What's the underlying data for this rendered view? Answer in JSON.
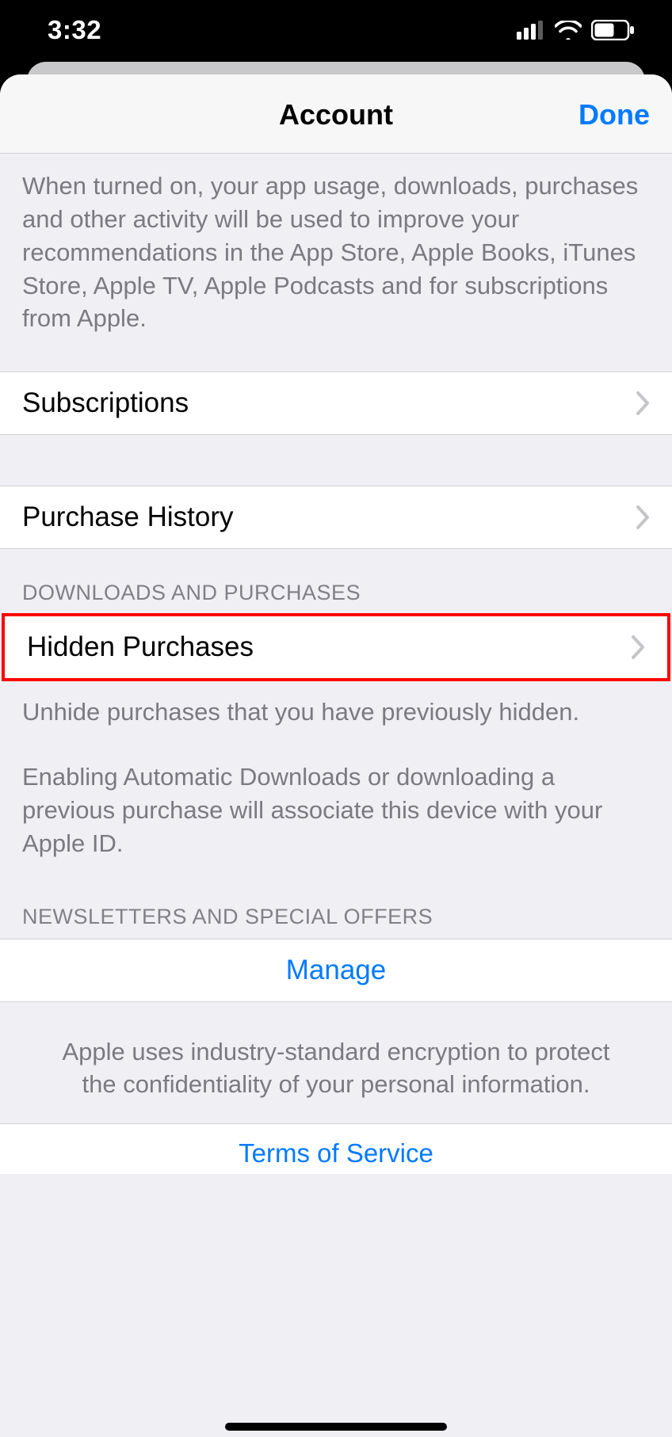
{
  "statusbar": {
    "time": "3:32"
  },
  "nav": {
    "title": "Account",
    "done": "Done"
  },
  "recommendations_footer": "When turned on, your app usage, downloads, purchases and other activity will be used to improve your recommendations in the App Store, Apple Books, iTunes Store, Apple TV, Apple Podcasts and for subscriptions from Apple.",
  "rows": {
    "subscriptions": "Subscriptions",
    "purchase_history": "Purchase History",
    "hidden_purchases": "Hidden Purchases",
    "manage": "Manage",
    "terms": "Terms of Service"
  },
  "section_headers": {
    "downloads": "DOWNLOADS AND PURCHASES",
    "newsletters": "NEWSLETTERS AND SPECIAL OFFERS"
  },
  "hidden_footer_line1": "Unhide purchases that you have previously hidden.",
  "hidden_footer_line2": "Enabling Automatic Downloads or downloading a previous purchase will associate this device with your Apple ID.",
  "encryption_note": "Apple uses industry-standard encryption to protect the confidentiality of your personal information."
}
